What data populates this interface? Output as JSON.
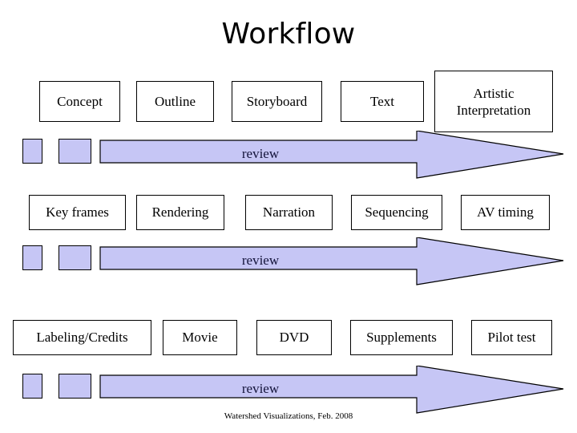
{
  "slide": {
    "title": "Workflow",
    "footer": "Watershed Visualizations, Feb. 2008",
    "colors": {
      "arrow_fill": "#c6c6f5",
      "arrow_stroke": "#000000",
      "box_fill": "#ffffff",
      "box_stroke": "#000000",
      "text": "#000000",
      "review_text": "#13133a",
      "background": "#ffffff"
    }
  },
  "rows": [
    {
      "id": "row-1",
      "boxes": [
        {
          "label": "Concept"
        },
        {
          "label": "Outline"
        },
        {
          "label": "Storyboard"
        },
        {
          "label": "Text"
        },
        {
          "label": "Artistic Interpretation"
        }
      ],
      "review_label": "review"
    },
    {
      "id": "row-2",
      "boxes": [
        {
          "label": "Key frames"
        },
        {
          "label": "Rendering"
        },
        {
          "label": "Narration"
        },
        {
          "label": "Sequencing"
        },
        {
          "label": "AV timing"
        }
      ],
      "review_label": "review"
    },
    {
      "id": "row-3",
      "boxes": [
        {
          "label": "Labeling/Credits"
        },
        {
          "label": "Movie"
        },
        {
          "label": "DVD"
        },
        {
          "label": "Supplements"
        },
        {
          "label": "Pilot test"
        }
      ],
      "review_label": "review"
    }
  ]
}
